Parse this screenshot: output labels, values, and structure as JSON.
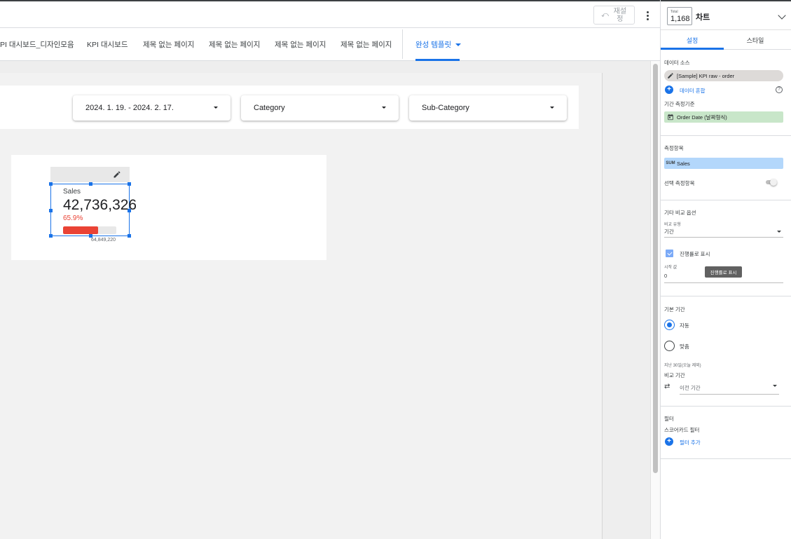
{
  "toolbar": {
    "reset_label": "재설정"
  },
  "tabs": [
    {
      "label": "PI 대시보드_디자인모음"
    },
    {
      "label": "KPI 대시보드"
    },
    {
      "label": "제목 없는 페이지"
    },
    {
      "label": "제목 없는 페이지"
    },
    {
      "label": "제목 없는 페이지"
    },
    {
      "label": "제목 없는 페이지"
    },
    {
      "label": "완성 템플릿"
    }
  ],
  "filters": {
    "date_range": "2024. 1. 19. - 2024. 2. 17.",
    "category": "Category",
    "sub_category": "Sub-Category"
  },
  "scorecard": {
    "label": "Sales",
    "value": "42,736,326",
    "percent": "65.9%",
    "progress_fraction": 0.659,
    "target": "64,849,220"
  },
  "panel": {
    "thumb_caption": "Total",
    "thumb_value": "1,168",
    "title": "차트",
    "tabs": {
      "setup": "설정",
      "style": "스타일"
    },
    "data_source_heading": "데이터 소스",
    "data_source_name": "[Sample] KPI raw - order",
    "blend_data": "데이터 혼합",
    "date_range_dimension_heading": "기간 측정기준",
    "date_range_dimension": "Order Date (날짜형식)",
    "metric_heading": "측정항목",
    "metric_agg": "SUM",
    "metric_name": "Sales",
    "optional_metrics": "선택 측정항목",
    "comparison_options_heading": "기타 비교 옵션",
    "comparison_type_label": "비교 유형",
    "comparison_type_value": "기간",
    "show_progress": "진행률로 표시",
    "start_value_label": "시작 값",
    "start_value": "0",
    "tooltip": "진행률로 표시",
    "default_date_range_heading": "기본 기간",
    "auto": "자동",
    "custom": "맞춤",
    "auto_hint": "지난 30일(오늘 제외)",
    "comparison_range_label": "비교 기간",
    "comparison_range_value": "이전 기간",
    "filter_heading": "필터",
    "scorecard_filter": "스코어카드 필터",
    "add_filter": "필터 추가"
  }
}
